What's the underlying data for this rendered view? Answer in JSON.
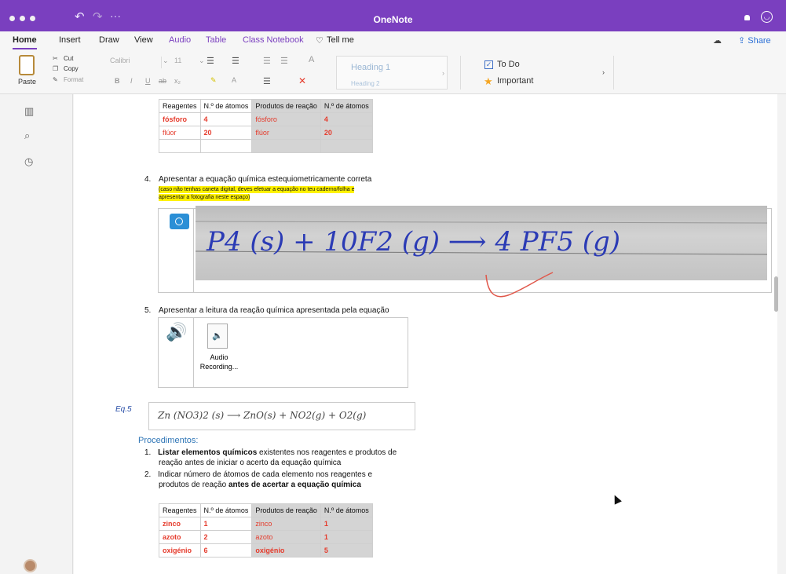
{
  "app": {
    "title": "OneNote"
  },
  "tabs": [
    "Home",
    "Insert",
    "Draw",
    "View",
    "Audio",
    "Table",
    "Class Notebook",
    "Tell me"
  ],
  "share_label": "Share",
  "ribbon": {
    "paste": "Paste",
    "cut": "Cut",
    "copy": "Copy",
    "format": "Format",
    "font": "Calibri",
    "size": "11",
    "heading1": "Heading 1",
    "heading2": "Heading 2",
    "todo": "To Do",
    "important": "Important"
  },
  "table1": {
    "headers": [
      "Reagentes",
      "N.º de átomos",
      "Produtos de reação",
      "N.º de átomos"
    ],
    "rows": [
      [
        "fósforo",
        "4",
        "fósforo",
        "4"
      ],
      [
        "flúor",
        "20",
        "flúor",
        "20"
      ],
      [
        "",
        "",
        "",
        ""
      ]
    ]
  },
  "step4": {
    "number": "4.",
    "text": "Apresentar a equação química estequiometricamente correta",
    "note_line1": "(caso não tenhas caneta digital, deves efetuar a equação no teu caderno/folha e",
    "note_line2": "apresentar a fotografia neste espaço)",
    "handwritten_equation": "P4 (s)  + 10F2 (g)  ⟶  4 PF5 (g)"
  },
  "step5": {
    "number": "5.",
    "text": "Apresentar a leitura da reação química apresentada pela equação",
    "audio_line1": "Audio",
    "audio_line2": "Recording..."
  },
  "eq5": {
    "label": "Eq.5",
    "handwritten": "Zn (NO3)2 (s)  ⟶  ZnO(s) + NO2(g) + O2(g)"
  },
  "procedures": {
    "title": "Procedimentos:",
    "item1_num": "1.",
    "item1_bold": "Listar  elementos químicos",
    "item1_rest": " existentes nos reagentes e produtos de",
    "item1_line2": "reação antes de iniciar o acerto da equação química",
    "item2_num": "2.",
    "item2_line1": "Indicar número de átomos de cada elemento nos reagentes e",
    "item2_line2_start": "produtos de reação ",
    "item2_line2_bold": "antes de acertar a equação química"
  },
  "table2": {
    "headers": [
      "Reagentes",
      "N.º de átomos",
      "Produtos de reação",
      "N.º de átomos"
    ],
    "rows": [
      [
        "zinco",
        "1",
        "zinco",
        "1"
      ],
      [
        "azoto",
        "2",
        "azoto",
        "1"
      ],
      [
        "oxigénio",
        "6",
        "oxigénio",
        "5"
      ]
    ]
  }
}
